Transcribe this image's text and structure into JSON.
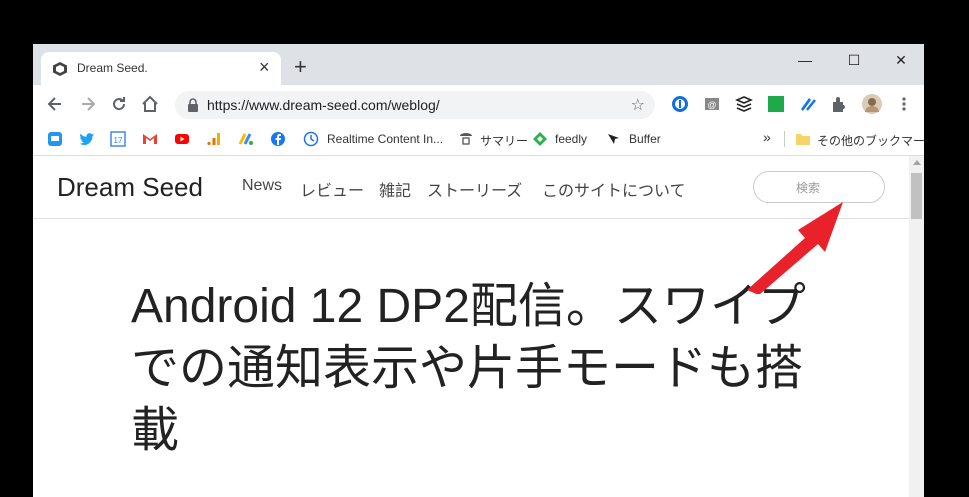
{
  "tab": {
    "title": "Dream Seed.",
    "close": "×"
  },
  "newtab": "+",
  "window": {
    "minimize": "—",
    "maximize": "☐",
    "close": "✕"
  },
  "url": "https://www.dream-seed.com/weblog/",
  "bookmarks": {
    "items": [
      {
        "label": "Realtime Content In..."
      },
      {
        "label": "サマリー"
      },
      {
        "label": "feedly"
      },
      {
        "label": "Buffer"
      }
    ],
    "overflow": "»",
    "other": "その他のブックマーク"
  },
  "site": {
    "title": "Dream Seed",
    "nav": [
      "News",
      "レビュー",
      "雑記",
      "ストーリーズ",
      "このサイトについて"
    ],
    "search_placeholder": "検索"
  },
  "headline": "Android 12 DP2配信。スワイプでの通知表示や片手モードも搭載",
  "colors": {
    "accent_red": "#e8212b",
    "tab_strip": "#dee1e6"
  }
}
